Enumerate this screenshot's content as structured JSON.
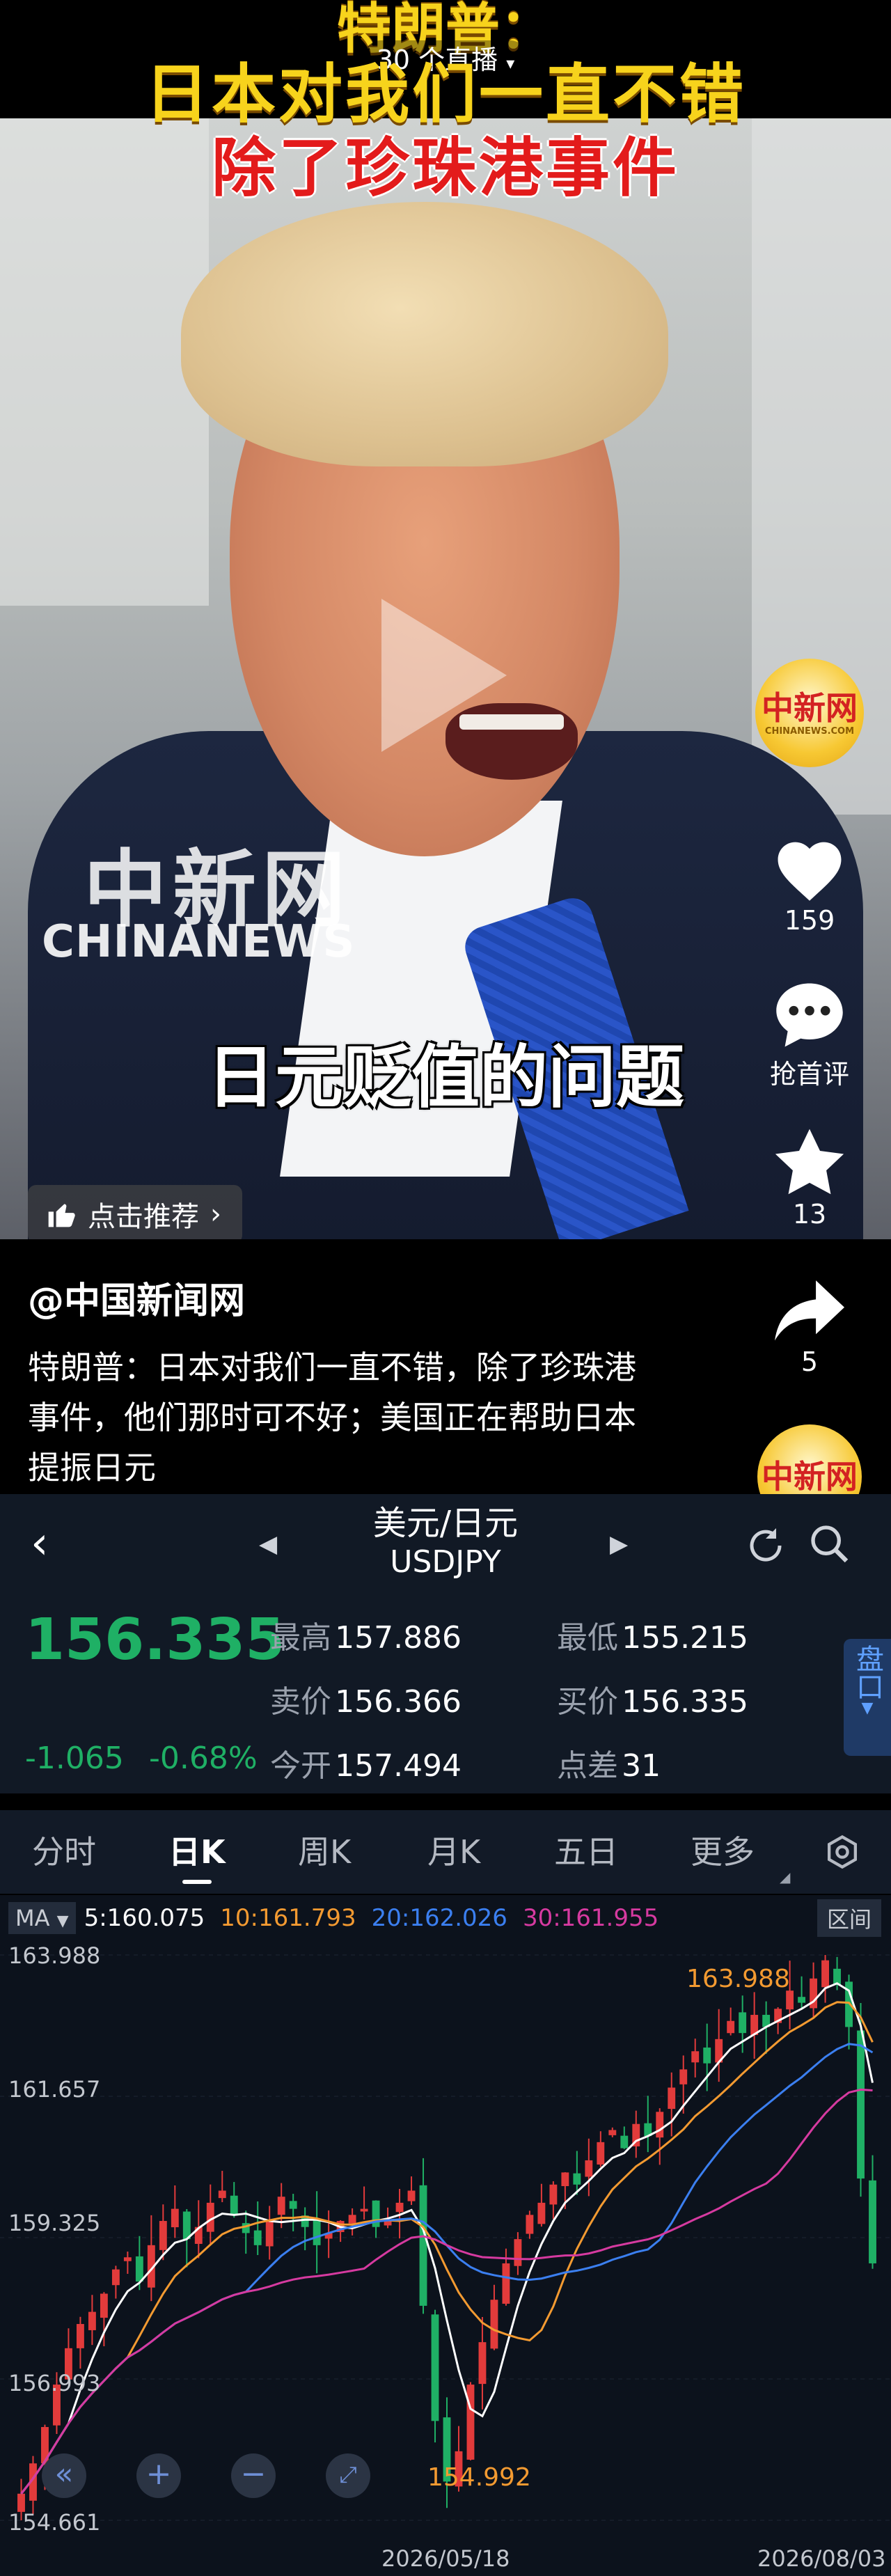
{
  "video": {
    "title_line1": "特朗普：",
    "title_line2": "日本对我们一直不错",
    "title_line3": "除了珍珠港事件",
    "live_badge": "30 个直播",
    "watermark_cn": "中新网",
    "watermark_en": "CHINANEWS",
    "subtitle": "日元贬值的问题",
    "recommend_label": "点击推荐"
  },
  "rail": {
    "logo_cn": "中新网",
    "logo_en": "CHINANEWS.COM",
    "likes": "159",
    "comment_label": "抢首评",
    "favorites": "13",
    "shares": "5"
  },
  "post": {
    "author": "@中国新闻网",
    "caption": "特朗普：日本对我们一直不错，除了珍珠港事件，他们那时可不好；美国正在帮助日本提振日元"
  },
  "quote": {
    "pair_cn": "美元/日元",
    "pair_code": "USDJPY",
    "price": "156.335",
    "change": "-1.065",
    "change_pct": "-0.68%",
    "high_label": "最高",
    "high": "157.886",
    "low_label": "最低",
    "low": "155.215",
    "sell_label": "卖价",
    "sell": "156.366",
    "buy_label": "买价",
    "buy": "156.335",
    "open_label": "今开",
    "open": "157.494",
    "spread_label": "点差",
    "spread": "31",
    "panel_tab": "盘口",
    "colors": {
      "down": "#1fb065",
      "up": "#e23b3b"
    }
  },
  "tabs": {
    "items": [
      "分时",
      "日K",
      "周K",
      "月K",
      "五日",
      "更多"
    ],
    "active": "日K"
  },
  "chart_data": {
    "type": "candlestick",
    "ma_label": "MA",
    "ma_values": {
      "ma5": "5:160.075",
      "ma10": "10:161.793",
      "ma20": "20:162.026",
      "ma30": "30:161.955"
    },
    "range_button": "区间",
    "y_ticks": [
      "163.988",
      "161.657",
      "159.325",
      "156.993",
      "154.661"
    ],
    "ylim": [
      154.661,
      163.988
    ],
    "x_ticks": [
      "2026/05/18",
      "2026/08/03"
    ],
    "annotations": {
      "max": "163.988",
      "min": "154.992"
    },
    "closes": [
      155.1,
      155.6,
      156.2,
      156.9,
      157.5,
      157.9,
      158.1,
      158.4,
      158.8,
      159.0,
      158.6,
      159.2,
      159.6,
      159.8,
      159.3,
      159.5,
      159.9,
      160.1,
      159.7,
      159.4,
      159.2,
      159.6,
      160.0,
      159.8,
      159.5,
      159.2,
      159.4,
      159.6,
      159.7,
      159.8,
      159.5,
      159.6,
      159.9,
      160.1,
      158.2,
      156.3,
      155.3,
      155.8,
      156.9,
      157.6,
      158.3,
      158.9,
      159.3,
      159.7,
      159.9,
      160.2,
      160.4,
      160.2,
      160.6,
      160.9,
      161.1,
      160.8,
      161.2,
      161.0,
      161.4,
      161.8,
      162.1,
      162.4,
      162.2,
      162.6,
      162.9,
      162.7,
      163.0,
      162.8,
      163.1,
      163.4,
      163.2,
      163.6,
      163.9,
      163.5,
      162.8,
      160.3,
      158.9
    ],
    "colors": {
      "up": "#e23b3b",
      "down": "#1fb065",
      "ma5": "#ffffff",
      "ma10": "#f39a31",
      "ma20": "#3b7ff0",
      "ma30": "#d63aa0"
    }
  }
}
